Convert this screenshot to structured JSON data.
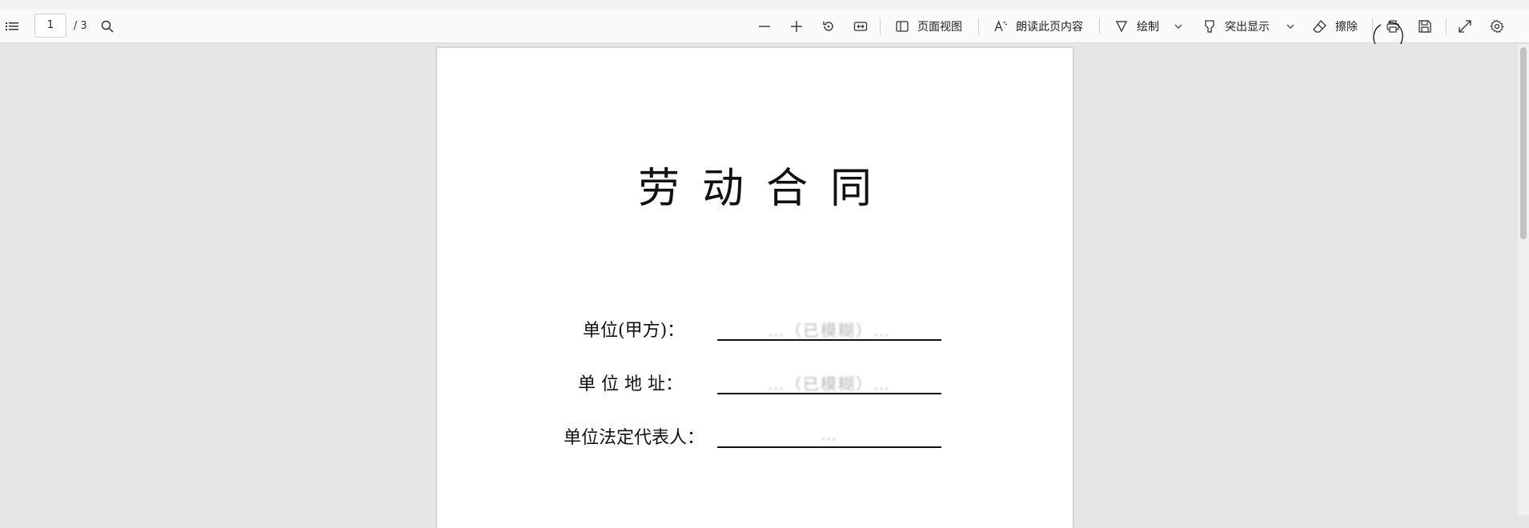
{
  "toolbar": {
    "page_current": "1",
    "page_total": "/ 3",
    "page_view_label": "页面视图",
    "read_aloud_label": "朗读此页内容",
    "draw_label": "绘制",
    "highlight_label": "突出显示",
    "erase_label": "擦除"
  },
  "document": {
    "title": "劳动合同",
    "fields": [
      {
        "label": "单位(甲方)：",
        "value": "…（已模糊）…"
      },
      {
        "label": "单 位 地 址：",
        "value": "…（已模糊）…"
      },
      {
        "label": "单位法定代表人：",
        "value": "…"
      }
    ]
  },
  "icons": {
    "contents": "list-icon",
    "search": "search-icon",
    "zoom_out": "minus-icon",
    "zoom_in": "plus-icon",
    "rotate": "rotate-icon",
    "fit": "fit-width-icon",
    "page_view": "page-view-icon",
    "read_aloud": "read-aloud-icon",
    "draw": "draw-icon",
    "highlight": "highlight-icon",
    "erase": "eraser-icon",
    "print": "print-icon",
    "save": "save-icon",
    "fullscreen": "expand-icon",
    "settings": "gear-icon"
  },
  "colors": {
    "toolbar_bg": "#fafafa",
    "viewer_bg": "#e6e6e6",
    "page_bg": "#ffffff"
  }
}
